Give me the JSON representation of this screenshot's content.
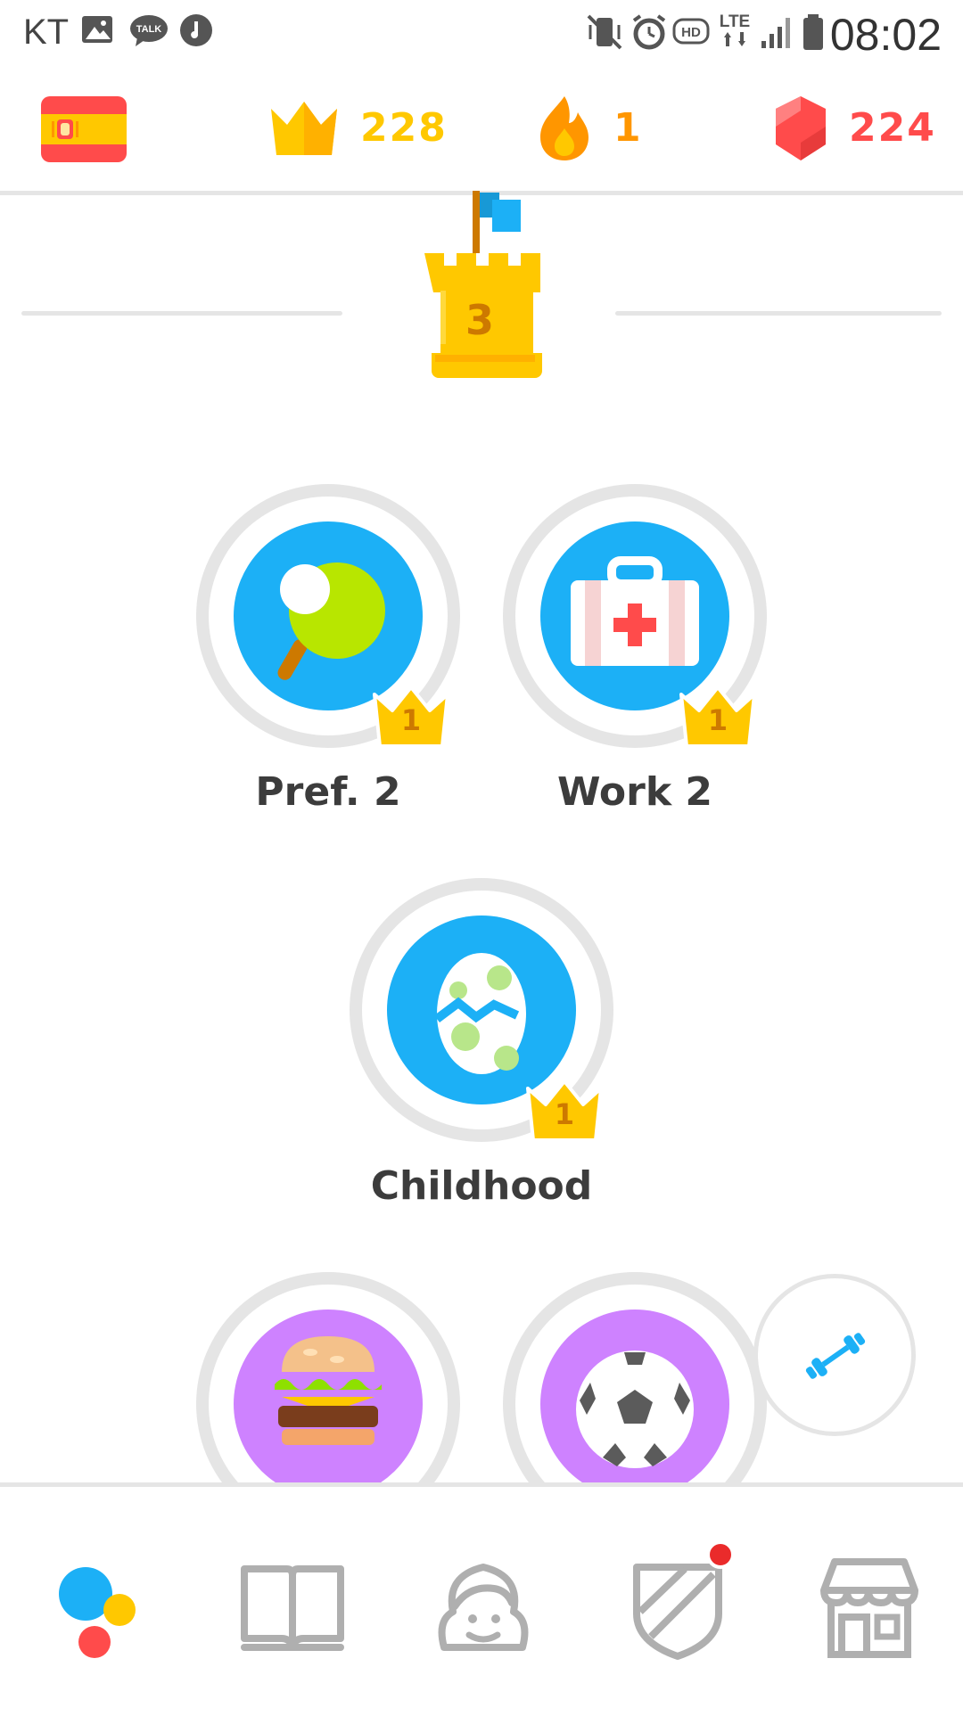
{
  "status_bar": {
    "carrier": "KT",
    "time": "08:02",
    "icons": [
      "gallery-icon",
      "kakaotalk-icon",
      "music-icon",
      "vibrate-mute-icon",
      "alarm-icon",
      "hd-voice-icon",
      "lte-icon",
      "signal-icon",
      "battery-icon"
    ],
    "talk_badge": "TALK",
    "hd_badge": "HD",
    "lte_badge": "LTE"
  },
  "stats": {
    "flag": "spanish-flag-icon",
    "crowns": "228",
    "streak": "1",
    "gems": "224",
    "colors": {
      "crowns": "#ffc800",
      "streak": "#ff9600",
      "gems": "#ff4b4b"
    }
  },
  "checkpoint": {
    "number": "3"
  },
  "skills": [
    {
      "label": "Pref. 2",
      "crown_level": "1",
      "color": "#1cb0f6",
      "icon": "ping-pong-paddle-icon"
    },
    {
      "label": "Work 2",
      "crown_level": "1",
      "color": "#1cb0f6",
      "icon": "first-aid-kit-icon"
    },
    {
      "label": "Childhood",
      "crown_level": "1",
      "color": "#1cb0f6",
      "icon": "cracked-egg-icon"
    },
    {
      "label": "",
      "crown_level": "",
      "color": "#ce82ff",
      "icon": "hamburger-icon"
    },
    {
      "label": "",
      "crown_level": "",
      "color": "#ce82ff",
      "icon": "soccer-ball-icon"
    }
  ],
  "fab": {
    "icon": "dumbbell-icon"
  },
  "bottom_nav": {
    "items": [
      {
        "name": "learn",
        "icon": "learn-dots-icon",
        "active": true
      },
      {
        "name": "stories",
        "icon": "book-icon",
        "active": false
      },
      {
        "name": "profile",
        "icon": "profile-avatar-icon",
        "active": false
      },
      {
        "name": "leagues",
        "icon": "shield-icon",
        "active": false,
        "notification": true
      },
      {
        "name": "shop",
        "icon": "shop-icon",
        "active": false
      }
    ]
  }
}
